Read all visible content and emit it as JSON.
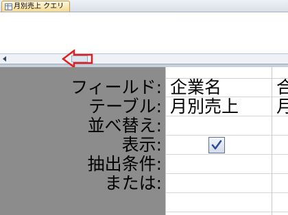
{
  "tab": {
    "title": "月別売上 クエリ"
  },
  "grid": {
    "row_labels": [
      "フィールド:",
      "テーブル:",
      "並べ替え:",
      "表示:",
      "抽出条件:",
      "または:"
    ],
    "columns": [
      {
        "field": "企業名",
        "table": "月別売上",
        "show": true
      },
      {
        "field": "合",
        "table": "月"
      }
    ]
  },
  "colors": {
    "annotation_arrow": "#e02020",
    "grid_background": "#8c8c8c"
  }
}
